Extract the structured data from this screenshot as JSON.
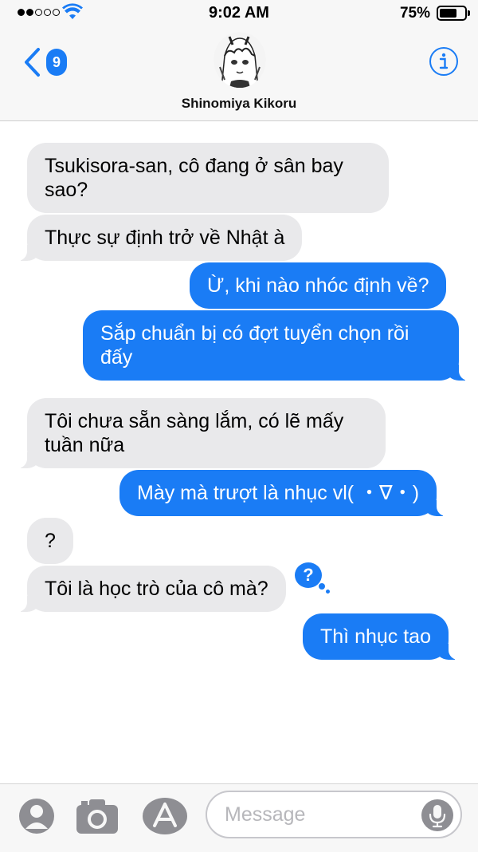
{
  "status_bar": {
    "time": "9:02 AM",
    "battery_percent": "75%",
    "battery_level": 0.75,
    "signal_bars_filled": 2,
    "signal_bars_total": 5,
    "wifi_icon": "wifi-icon"
  },
  "header": {
    "back_badge": "9",
    "contact_name": "Shinomiya Kikoru",
    "back_icon": "chevron-left-icon",
    "info_icon": "info-icon",
    "avatar_icon": "avatar"
  },
  "messages": [
    {
      "direction": "in",
      "text": "Tsukisora-san, cô đang ở sân bay sao?"
    },
    {
      "direction": "in",
      "text": "Thực sự định trở về Nhật à"
    },
    {
      "direction": "out",
      "text": "Ừ, khi nào nhóc định về?"
    },
    {
      "direction": "out",
      "text": "Sắp chuẩn bị có đợt tuyển chọn rồi đấy"
    },
    {
      "direction": "in",
      "text": "Tôi chưa sẵn sàng lắm, có lẽ  mấy tuần nữa"
    },
    {
      "direction": "out",
      "text": "Mày mà trượt là nhục vl( ・∇・)"
    },
    {
      "direction": "in",
      "text": "?"
    },
    {
      "direction": "in",
      "text": "Tôi là học trò của cô mà?",
      "reaction": "?"
    },
    {
      "direction": "out",
      "text": "Thì nhục tao"
    }
  ],
  "input_bar": {
    "placeholder": "Message",
    "icons": [
      "contact-icon",
      "camera-icon",
      "appstore-icon",
      "microphone-icon"
    ]
  },
  "colors": {
    "accent": "#1a7cf5",
    "incoming_bubble": "#e9e9eb",
    "header_background": "#f7f7f7"
  }
}
